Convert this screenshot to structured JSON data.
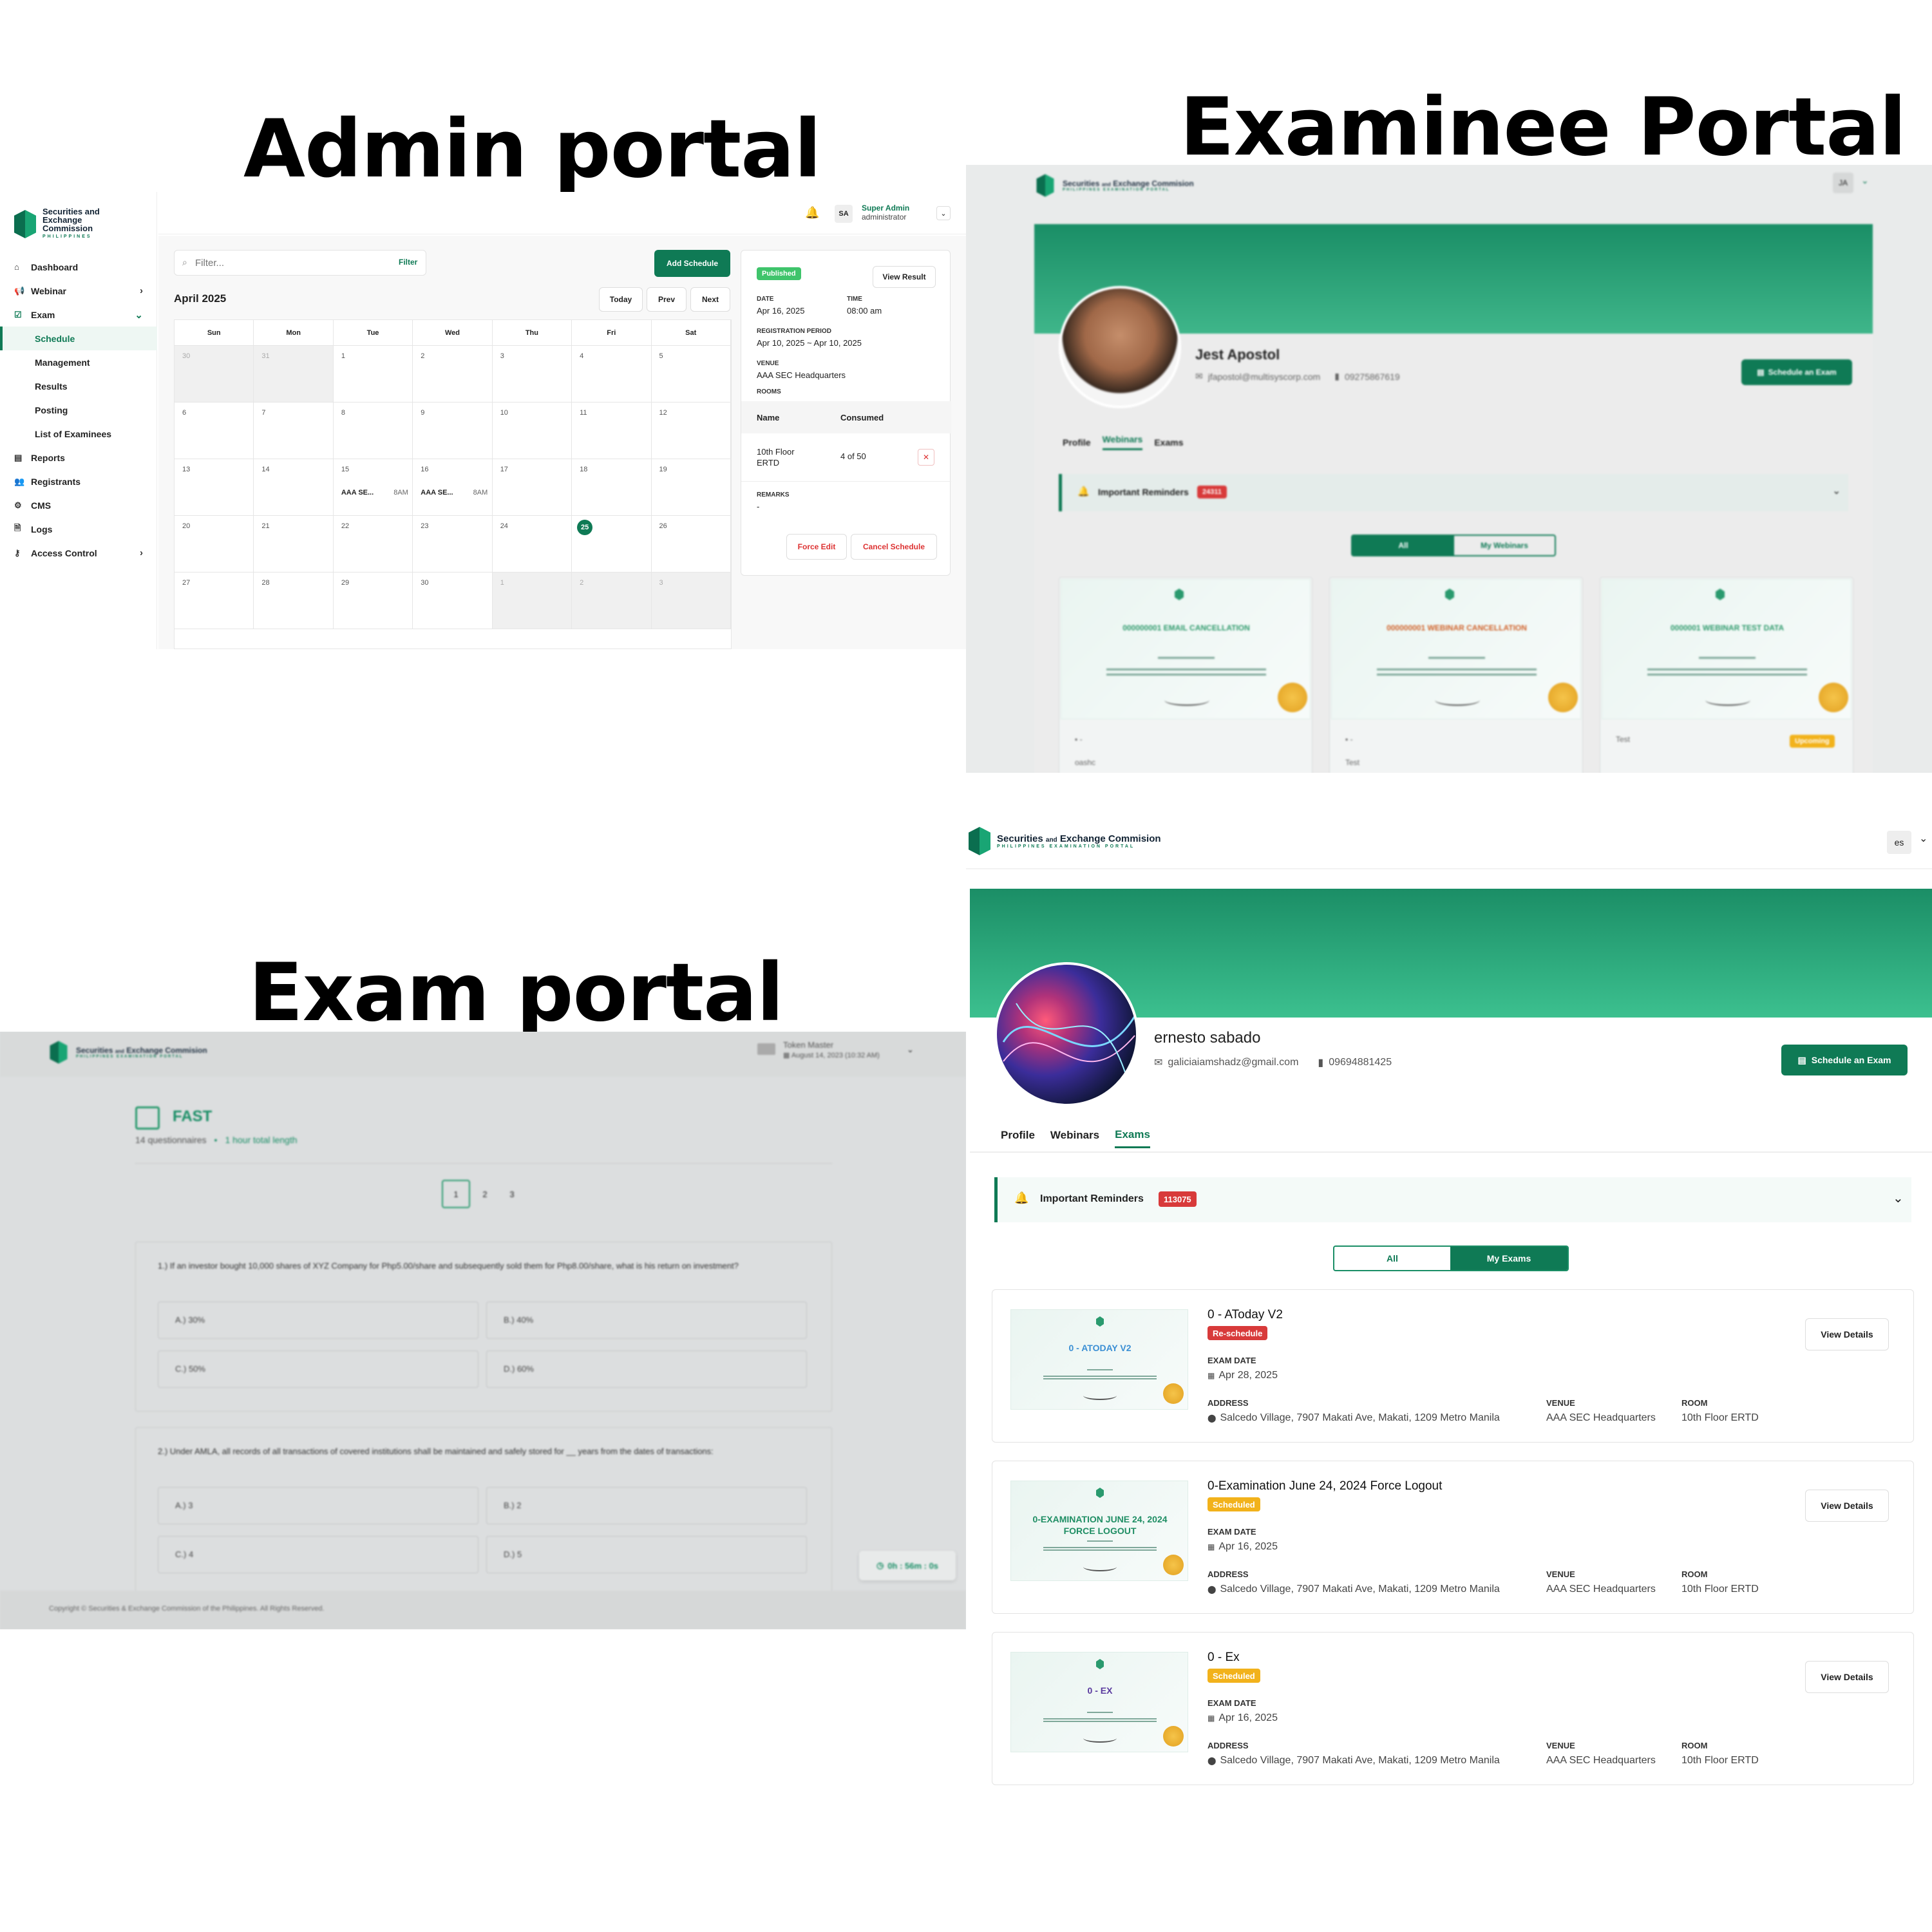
{
  "headings": {
    "admin": "Admin portal",
    "examinee": "Examinee Portal",
    "exam": "Exam portal"
  },
  "brand": {
    "sec_lines": [
      "Securities and",
      "Exchange",
      "Commission"
    ],
    "sec_sub": "PHILIPPINES",
    "portal_name_a": "Securities",
    "portal_name_and": "and",
    "portal_name_b": "Exchange Commision",
    "portal_sub": "PHILIPPINES EXAMINATION PORTAL",
    "green": "#0f7a55"
  },
  "admin": {
    "sidebar": [
      {
        "label": "Dashboard",
        "icon": "home-icon",
        "chev": ""
      },
      {
        "label": "Webinar",
        "icon": "megaphone-icon",
        "chev": "›"
      },
      {
        "label": "Exam",
        "icon": "clipboard-check-icon",
        "chev": "⌄"
      },
      {
        "label": "Schedule",
        "sub": true,
        "active": true
      },
      {
        "label": "Management",
        "sub": true
      },
      {
        "label": "Results",
        "sub": true
      },
      {
        "label": "Posting",
        "sub": true
      },
      {
        "label": "List of Examinees",
        "sub": true
      },
      {
        "label": "Reports",
        "icon": "report-icon",
        "chev": ""
      },
      {
        "label": "Registrants",
        "icon": "users-icon",
        "chev": ""
      },
      {
        "label": "CMS",
        "icon": "gear-icon",
        "chev": ""
      },
      {
        "label": "Logs",
        "icon": "log-icon",
        "chev": ""
      },
      {
        "label": "Access Control",
        "icon": "access-icon",
        "chev": "›"
      }
    ],
    "user": {
      "initials": "SA",
      "name": "Super Admin",
      "role": "administrator"
    },
    "filter_placeholder": "Filter...",
    "filter_btn": "Filter",
    "add_schedule": "Add Schedule",
    "month": "April 2025",
    "today": "Today",
    "prev": "Prev",
    "next": "Next",
    "weekdays": [
      "Sun",
      "Mon",
      "Tue",
      "Wed",
      "Thu",
      "Fri",
      "Sat"
    ],
    "days": [
      [
        "30",
        "31",
        "1",
        "2",
        "3",
        "4",
        "5"
      ],
      [
        "6",
        "7",
        "8",
        "9",
        "10",
        "11",
        "12"
      ],
      [
        "13",
        "14",
        "15",
        "16",
        "17",
        "18",
        "19"
      ],
      [
        "20",
        "21",
        "22",
        "23",
        "24",
        "25",
        "26"
      ],
      [
        "27",
        "28",
        "29",
        "30",
        "1",
        "2",
        "3"
      ]
    ],
    "events": [
      {
        "row": 2,
        "col": 2,
        "title": "AAA SE...",
        "time": "8AM"
      },
      {
        "row": 2,
        "col": 3,
        "title": "AAA SE...",
        "time": "8AM"
      }
    ],
    "detail": {
      "status": "Published",
      "view_result": "View Result",
      "date_label": "DATE",
      "date": "Apr 16, 2025",
      "time_label": "TIME",
      "time": "08:00 am",
      "reg_label": "REGISTRATION PERIOD",
      "reg": "Apr 10, 2025 ~ Apr 10, 2025",
      "venue_label": "VENUE",
      "venue": "AAA SEC Headquarters",
      "rooms_label": "ROOMS",
      "col_name": "Name",
      "col_consumed": "Consumed",
      "room_name_1": "10th Floor",
      "room_name_2": "ERTD",
      "room_consumed": "4 of 50",
      "remarks_label": "REMARKS",
      "remarks": "-",
      "force_edit": "Force Edit",
      "cancel": "Cancel Schedule"
    }
  },
  "examinee_top": {
    "avatar_initials": "JA",
    "name": "Jest Apostol",
    "email": "jfapostol@multisyscorp.com",
    "phone": "09275867619",
    "schedule_btn": "Schedule an Exam",
    "tabs": [
      "Profile",
      "Webinars",
      "Exams"
    ],
    "reminders": "Important Reminders",
    "reminders_count": "24311",
    "toggle": [
      "All",
      "My Webinars"
    ],
    "cards": [
      {
        "title": "000000001 EMAIL CANCELLATION",
        "color": "#2f9a6c",
        "foot1": "▪ -",
        "foot2": "oashc",
        "badge": ""
      },
      {
        "title": "000000001 WEBINAR CANCELLATION",
        "color": "#d0622a",
        "foot1": "▪ -",
        "foot2": "Test",
        "badge": ""
      },
      {
        "title": "0000001 WEBINAR TEST DATA",
        "color": "#2f9a6c",
        "foot1": "Test",
        "foot2": "",
        "badge": "Upcoming"
      }
    ]
  },
  "exam_portal": {
    "user": "Token Master",
    "date": "August 14, 2023 (10:32 AM)",
    "title": "FAST",
    "questionnaires": "14 questionnaires",
    "length": "1 hour total length",
    "pages": [
      "1",
      "2",
      "3"
    ],
    "questions": [
      {
        "text": "1.) If an investor bought 10,000 shares of XYZ Company for Php5.00/share and subsequently sold them for Php8.00/share, what is his return on investment?",
        "options": [
          "A.) 30%",
          "B.) 40%",
          "C.) 50%",
          "D.) 60%"
        ]
      },
      {
        "text": "2.) Under AMLA, all records of all transactions of covered institutions shall be maintained and safely stored for __ years from the dates of transactions:",
        "options": [
          "A.) 3",
          "B.) 2",
          "C.) 4",
          "D.) 5"
        ]
      }
    ],
    "timer": "0h : 56m : 0s",
    "copyright": "Copyright © Securities & Exchange Commission of the Philippines. All Rights Reserved."
  },
  "examinee_bottom": {
    "avatar_initials": "es",
    "name": "ernesto sabado",
    "email": "galiciaiamshadz@gmail.com",
    "phone": "09694881425",
    "schedule_btn": "Schedule an Exam",
    "tabs": [
      "Profile",
      "Webinars",
      "Exams"
    ],
    "reminders": "Important Reminders",
    "reminders_count": "113075",
    "toggle": [
      "All",
      "My Exams"
    ],
    "labels": {
      "exam_date": "EXAM DATE",
      "address": "ADDRESS",
      "venue": "VENUE",
      "room": "ROOM",
      "view": "View Details"
    },
    "exams": [
      {
        "title": "0 - AToday V2",
        "cert": "0 - ATODAY V2",
        "cert_color": "#3b8fd4",
        "badge": "Re-schedule",
        "badge_color": "#d83a3a",
        "date": "Apr 28, 2025",
        "address": "Salcedo Village, 7907 Makati Ave, Makati, 1209 Metro Manila",
        "venue": "AAA SEC Headquarters",
        "room": "10th Floor ERTD"
      },
      {
        "title": "0-Examination June 24, 2024 Force Logout",
        "cert": "0-EXAMINATION JUNE 24, 2024 FORCE LOGOUT",
        "cert_color": "#1f8e64",
        "badge": "Scheduled",
        "badge_color": "#f2b21b",
        "date": "Apr 16, 2025",
        "address": "Salcedo Village, 7907 Makati Ave, Makati, 1209 Metro Manila",
        "venue": "AAA SEC Headquarters",
        "room": "10th Floor ERTD"
      },
      {
        "title": "0 - Ex",
        "cert": "0 - EX",
        "cert_color": "#5a3a9e",
        "badge": "Scheduled",
        "badge_color": "#f2b21b",
        "date": "Apr 16, 2025",
        "address": "Salcedo Village, 7907 Makati Ave, Makati, 1209 Metro Manila",
        "venue": "AAA SEC Headquarters",
        "room": "10th Floor ERTD"
      }
    ]
  }
}
